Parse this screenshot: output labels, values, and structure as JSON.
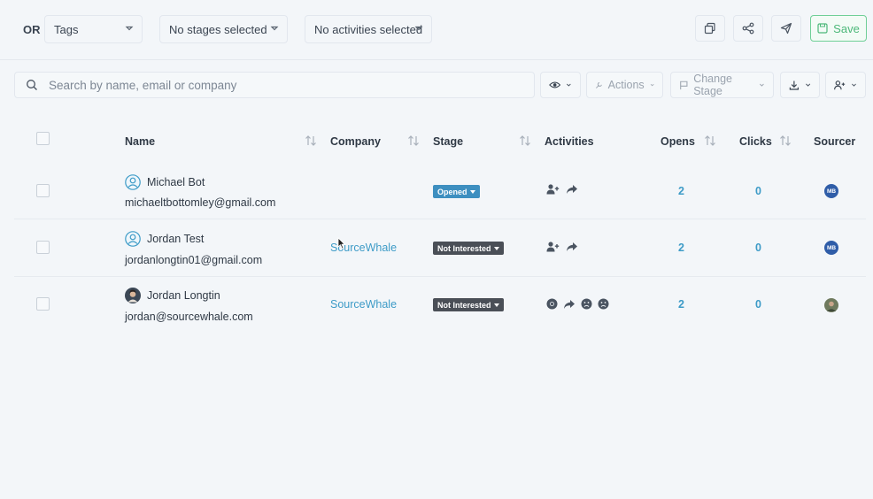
{
  "filters": {
    "or_label": "OR",
    "tags": "Tags",
    "stages": "No stages selected",
    "activities": "No activities selected",
    "save_label": "Save"
  },
  "search": {
    "placeholder": "Search by name, email or company"
  },
  "toolbar": {
    "actions_label": "Actions",
    "change_stage_label": "Change Stage"
  },
  "table": {
    "headers": {
      "name": "Name",
      "company": "Company",
      "stage": "Stage",
      "activities": "Activities",
      "opens": "Opens",
      "clicks": "Clicks",
      "sourcer": "Sourcer"
    },
    "rows": [
      {
        "name": "Michael Bot",
        "email": "michaeltbottomley@gmail.com",
        "company": "",
        "stage": "Opened",
        "opens": "2",
        "clicks": "0",
        "sourcer": "MB"
      },
      {
        "name": "Jordan Test",
        "email": "jordanlongtin01@gmail.com",
        "company": "SourceWhale",
        "stage": "Not Interested",
        "opens": "2",
        "clicks": "0",
        "sourcer": "MB"
      },
      {
        "name": "Jordan Longtin",
        "email": "jordan@sourcewhale.com",
        "company": "SourceWhale",
        "stage": "Not Interested",
        "opens": "2",
        "clicks": "0",
        "sourcer": ""
      }
    ]
  },
  "colors": {
    "accent": "#3d9bc7",
    "opened_badge": "#3d8fc0",
    "not_interested_badge": "#4a4f57",
    "save_green": "#4cb879"
  }
}
